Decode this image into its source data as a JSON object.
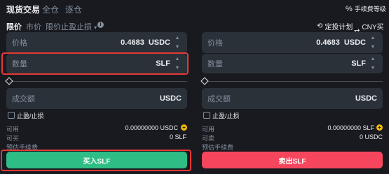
{
  "header": {
    "tabs": [
      {
        "label": "现货交易"
      },
      {
        "label": "全仓"
      },
      {
        "label": "逐仓"
      }
    ],
    "fee_level_label": "手续费等级"
  },
  "order_types": {
    "limit": "限价",
    "market": "市价",
    "stop_limit": "限价止盈止损",
    "dip_plan": "定投计划",
    "cny_buy": "CNY买币"
  },
  "buy": {
    "price_label": "价格",
    "price_value": "0.4683",
    "price_unit": "USDC",
    "amount_label": "数量",
    "amount_unit": "SLF",
    "total_label": "成交额",
    "total_unit": "USDC",
    "tpsl_label": "止盈/止损",
    "available_label": "可用",
    "available_value": "0.00000000 USDC",
    "max_label": "可买",
    "max_value": "0 SLF",
    "fee_label": "预估手续费",
    "button_label": "买入SLF"
  },
  "sell": {
    "price_label": "价格",
    "price_value": "0.4683",
    "price_unit": "USDC",
    "amount_label": "数量",
    "amount_unit": "SLF",
    "total_label": "成交额",
    "total_unit": "USDC",
    "tpsl_label": "止盈/止损",
    "available_label": "可用",
    "available_value": "0.00000000 SLF",
    "max_label": "可卖",
    "max_value": "0 USDC",
    "fee_label": "预估手续费",
    "button_label": "卖出SLF"
  },
  "colors": {
    "buy": "#2ebd85",
    "sell": "#f6465d",
    "highlight": "#e53935",
    "accent": "#f0b90b"
  }
}
